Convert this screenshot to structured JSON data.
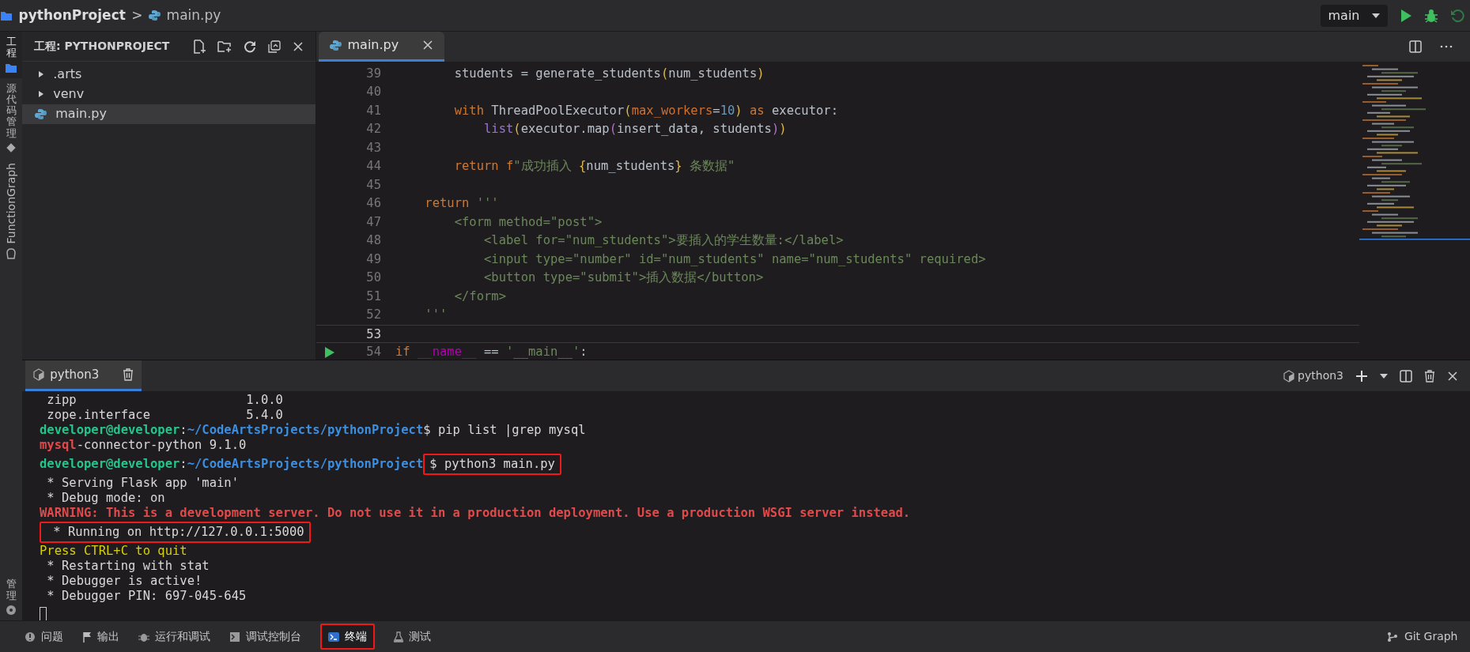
{
  "breadcrumb": {
    "project": "pythonProject",
    "separator": ">",
    "file": "main.py"
  },
  "run_config": {
    "label": "main"
  },
  "activity_bar": [
    {
      "label": "工程",
      "kind": "folder",
      "selected": true
    },
    {
      "label": "源代码管理",
      "kind": "git",
      "selected": false
    },
    {
      "label": "FunctionGraph",
      "kind": "function",
      "selected": false
    },
    {
      "label": "管理",
      "kind": "gear",
      "selected": false
    }
  ],
  "explorer": {
    "title": "工程: PYTHONPROJECT",
    "items": [
      {
        "label": ".arts",
        "kind": "folder",
        "expanded": false,
        "selected": false
      },
      {
        "label": "venv",
        "kind": "folder",
        "expanded": false,
        "selected": false
      },
      {
        "label": "main.py",
        "kind": "python",
        "selected": true
      }
    ]
  },
  "editor": {
    "tabs": [
      {
        "label": "main.py",
        "selected": true
      }
    ],
    "lines": [
      {
        "number": "39",
        "current": false,
        "runnable": false,
        "tokens": [
          {
            "text": "        students = generate_students",
            "kind": "plain"
          },
          {
            "text": "(",
            "kind": "paren"
          },
          {
            "text": "num_students",
            "kind": "plain"
          },
          {
            "text": ")",
            "kind": "paren"
          }
        ]
      },
      {
        "number": "40",
        "current": false,
        "runnable": false
      },
      {
        "number": "41",
        "current": false,
        "runnable": false,
        "tokens": [
          {
            "text": "        with",
            "kind": "kw"
          },
          {
            "text": " ThreadPoolExecutor",
            "kind": "plain"
          },
          {
            "text": "(",
            "kind": "paren"
          },
          {
            "text": "max_workers",
            "kind": "param"
          },
          {
            "text": "=",
            "kind": "plain"
          },
          {
            "text": "10",
            "kind": "num"
          },
          {
            "text": ")",
            "kind": "paren"
          },
          {
            "text": " as",
            "kind": "kw"
          },
          {
            "text": " executor:",
            "kind": "plain"
          }
        ]
      },
      {
        "number": "42",
        "current": false,
        "runnable": false,
        "tokens": [
          {
            "text": "            list",
            "kind": "builtin"
          },
          {
            "text": "(",
            "kind": "paren"
          },
          {
            "text": "executor.map",
            "kind": "plain"
          },
          {
            "text": "(",
            "kind": "paren2"
          },
          {
            "text": "insert_data, students",
            "kind": "plain"
          },
          {
            "text": ")",
            "kind": "paren2"
          },
          {
            "text": ")",
            "kind": "paren"
          }
        ]
      },
      {
        "number": "43",
        "current": false,
        "runnable": false
      },
      {
        "number": "44",
        "current": false,
        "runnable": false,
        "tokens": [
          {
            "text": "        return",
            "kind": "kw"
          },
          {
            "text": " f",
            "kind": "kw"
          },
          {
            "text": "\"成功插入 ",
            "kind": "str"
          },
          {
            "text": "{",
            "kind": "paren"
          },
          {
            "text": "num_students",
            "kind": "plain"
          },
          {
            "text": "}",
            "kind": "paren"
          },
          {
            "text": " 条数据\"",
            "kind": "str"
          }
        ]
      },
      {
        "number": "45",
        "current": false,
        "runnable": false
      },
      {
        "number": "46",
        "current": false,
        "runnable": false,
        "tokens": [
          {
            "text": "    return",
            "kind": "kw"
          },
          {
            "text": " '''",
            "kind": "str"
          }
        ]
      },
      {
        "number": "47",
        "current": false,
        "runnable": false,
        "tokens": [
          {
            "text": "        <form method=\"post\">",
            "kind": "str"
          }
        ]
      },
      {
        "number": "48",
        "current": false,
        "runnable": false,
        "tokens": [
          {
            "text": "            <label for=\"num_students\">要插入的学生数量:</label>",
            "kind": "str"
          }
        ]
      },
      {
        "number": "49",
        "current": false,
        "runnable": false,
        "tokens": [
          {
            "text": "            <input type=\"number\" id=\"num_students\" name=\"num_students\" required>",
            "kind": "str"
          }
        ]
      },
      {
        "number": "50",
        "current": false,
        "runnable": false,
        "tokens": [
          {
            "text": "            <button type=\"submit\">插入数据</button>",
            "kind": "str"
          }
        ]
      },
      {
        "number": "51",
        "current": false,
        "runnable": false,
        "tokens": [
          {
            "text": "        </form>",
            "kind": "str"
          }
        ]
      },
      {
        "number": "52",
        "current": false,
        "runnable": false,
        "tokens": [
          {
            "text": "    '''",
            "kind": "str"
          }
        ]
      },
      {
        "number": "53",
        "current": true,
        "runnable": false
      },
      {
        "number": "54",
        "current": false,
        "runnable": true,
        "tokens": [
          {
            "text": "if ",
            "kind": "kw"
          },
          {
            "text": "__name__",
            "kind": "magic"
          },
          {
            "text": " == ",
            "kind": "plain"
          },
          {
            "text": "'__main__'",
            "kind": "str"
          },
          {
            "text": ":",
            "kind": "plain"
          }
        ]
      }
    ]
  },
  "panel": {
    "tabs": [
      {
        "label": "python3",
        "selected": true
      }
    ],
    "shell": "python3",
    "lines": [
      {
        "segments": [
          {
            "text": " zipp                       1.0.0",
            "kind": "plain",
            "highlighted": false
          }
        ]
      },
      {
        "segments": [
          {
            "text": " zope.interface             5.4.0",
            "kind": "plain",
            "highlighted": false
          }
        ]
      },
      {
        "segments": [
          {
            "text": "developer@developer",
            "kind": "user",
            "highlighted": false
          },
          {
            "text": ":",
            "kind": "plain",
            "highlighted": false
          },
          {
            "text": "~/CodeArtsProjects/pythonProject",
            "kind": "path",
            "highlighted": false
          },
          {
            "text": "$ pip list |grep mysql",
            "kind": "plain",
            "highlighted": false
          }
        ]
      },
      {
        "segments": [
          {
            "text": "mysql",
            "kind": "error",
            "highlighted": false
          },
          {
            "text": "-connector-python 9.1.0",
            "kind": "plain",
            "highlighted": false
          }
        ]
      },
      {
        "segments": [
          {
            "text": "developer@developer",
            "kind": "user",
            "highlighted": false
          },
          {
            "text": ":",
            "kind": "plain",
            "highlighted": false
          },
          {
            "text": "~/CodeArtsProjects/pythonProject",
            "kind": "path",
            "highlighted": false
          },
          {
            "text": "$ python3 main.py",
            "kind": "plain",
            "highlighted": true
          }
        ]
      },
      {
        "segments": [
          {
            "text": " * Serving Flask app 'main'",
            "kind": "plain",
            "highlighted": false
          }
        ]
      },
      {
        "segments": [
          {
            "text": " * Debug mode: on",
            "kind": "plain",
            "highlighted": false
          }
        ]
      },
      {
        "segments": [
          {
            "text": "WARNING: This is a development server. Do not use it in a production deployment. Use a production WSGI server instead.",
            "kind": "error",
            "highlighted": false
          }
        ]
      },
      {
        "segments": [
          {
            "text": " * Running on http://127.0.0.1:5000",
            "kind": "plain",
            "highlighted": true
          }
        ]
      },
      {
        "segments": [
          {
            "text": "Press CTRL+C to quit",
            "kind": "warn",
            "highlighted": false
          }
        ]
      },
      {
        "segments": [
          {
            "text": " * Restarting with stat",
            "kind": "plain",
            "highlighted": false
          }
        ]
      },
      {
        "segments": [
          {
            "text": " * Debugger is active!",
            "kind": "plain",
            "highlighted": false
          }
        ]
      },
      {
        "segments": [
          {
            "text": " * Debugger PIN: 697-045-645",
            "kind": "plain",
            "highlighted": false
          }
        ]
      }
    ]
  },
  "status_bar": {
    "panels": [
      {
        "label": "问题",
        "kind": "problems",
        "selected": false,
        "highlighted": false
      },
      {
        "label": "输出",
        "kind": "output",
        "selected": false,
        "highlighted": false
      },
      {
        "label": "运行和调试",
        "kind": "debug",
        "selected": false,
        "highlighted": false
      },
      {
        "label": "调试控制台",
        "kind": "console",
        "selected": false,
        "highlighted": false
      },
      {
        "label": "终端",
        "kind": "terminal",
        "selected": true,
        "highlighted": true
      },
      {
        "label": "测试",
        "kind": "test",
        "selected": false,
        "highlighted": false
      }
    ],
    "right": "Git Graph"
  }
}
